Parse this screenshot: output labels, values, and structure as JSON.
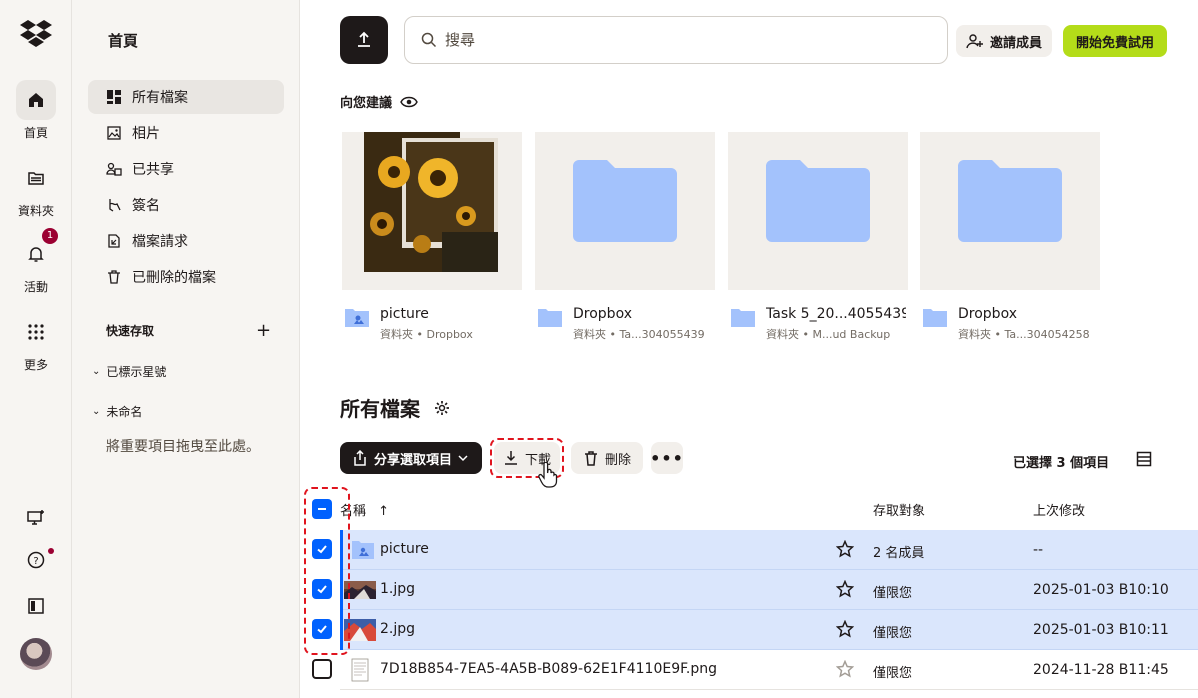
{
  "rail": {
    "items": [
      {
        "label": "首頁",
        "icon": "home-icon"
      },
      {
        "label": "資料夾",
        "icon": "folder-icon"
      },
      {
        "label": "活動",
        "icon": "bell-icon",
        "badge": "1"
      },
      {
        "label": "更多",
        "icon": "grid-icon"
      }
    ]
  },
  "side": {
    "title": "首頁",
    "nav": [
      {
        "label": "所有檔案",
        "icon": "files-icon",
        "active": true
      },
      {
        "label": "相片",
        "icon": "photo-icon"
      },
      {
        "label": "已共享",
        "icon": "shared-icon"
      },
      {
        "label": "簽名",
        "icon": "signature-icon"
      },
      {
        "label": "檔案請求",
        "icon": "file-request-icon"
      },
      {
        "label": "已刪除的檔案",
        "icon": "trash-icon"
      }
    ],
    "quick_access": "快速存取",
    "starred": "已標示星號",
    "unnamed": "未命名",
    "drop_hint": "將重要項目拖曳至此處。"
  },
  "header": {
    "search_placeholder": "搜尋",
    "invite": "邀請成員",
    "trial": "開始免費試用"
  },
  "suggestions": {
    "title": "向您建議",
    "cards": [
      {
        "name": "picture",
        "sub": "資料夾 • Dropbox",
        "type": "shared-folder"
      },
      {
        "name": "Dropbox",
        "sub": "資料夾 • Ta...304055439",
        "type": "folder"
      },
      {
        "name": "Task 5_20...4055439",
        "sub": "資料夾 • M...ud Backup",
        "type": "folder"
      },
      {
        "name": "Dropbox",
        "sub": "資料夾 • Ta...304054258",
        "type": "folder"
      }
    ]
  },
  "files": {
    "title": "所有檔案",
    "toolbar": {
      "share": "分享選取項目",
      "download": "下載",
      "delete": "刪除",
      "selected": "已選擇 3 個項目"
    },
    "columns": {
      "name": "名稱",
      "access": "存取對象",
      "modified": "上次修改"
    },
    "rows": [
      {
        "name": "picture",
        "access": "2 名成員",
        "modified": "--",
        "selected": true,
        "thumb": "shared-folder"
      },
      {
        "name": "1.jpg",
        "access": "僅限您",
        "modified": "2025-01-03 B10:10",
        "selected": true,
        "thumb": "image"
      },
      {
        "name": "2.jpg",
        "access": "僅限您",
        "modified": "2025-01-03 B10:11",
        "selected": true,
        "thumb": "image"
      },
      {
        "name": "7D18B854-7EA5-4A5B-B089-62E1F4110E9F.png",
        "access": "僅限您",
        "modified": "2024-11-28 B11:45",
        "selected": false,
        "thumb": "document"
      }
    ]
  },
  "colors": {
    "accent": "#0061fe",
    "trial": "#b4dc19",
    "selected_row": "#dae6fc",
    "highlight": "#e0141e",
    "badge": "#9b0032"
  }
}
